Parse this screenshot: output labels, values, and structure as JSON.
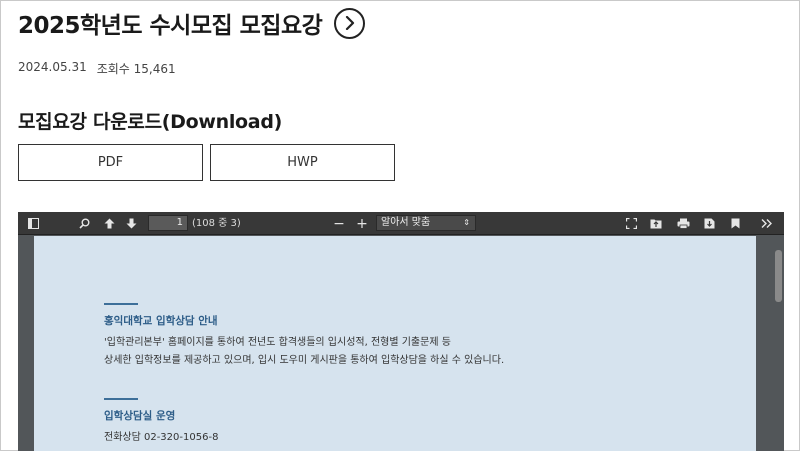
{
  "header": {
    "title": "2025학년도 수시모집 모집요강",
    "date": "2024.05.31",
    "views": "조회수 15,461"
  },
  "download": {
    "heading": "모집요강 다운로드(Download)",
    "buttons": [
      "PDF",
      "HWP"
    ]
  },
  "viewer": {
    "toolbar": {
      "page_number": "1",
      "page_count": "(108 중 3)",
      "zoom_label": "알아서 맞춤",
      "zoom_out": "−",
      "zoom_in": "+",
      "icons": [
        "sidebar-toggle-icon",
        "search-icon",
        "prev-page-icon",
        "next-page-icon",
        "zoom-out-icon",
        "zoom-in-icon",
        "fullscreen-icon",
        "open-file-icon",
        "print-icon",
        "download-icon",
        "bookmark-icon",
        "more-tools-icon"
      ]
    },
    "document": {
      "section1": {
        "heading": "홍익대학교 입학상담 안내",
        "lines": [
          "'입학관리본부' 홈페이지를 통하여 전년도 합격생들의 입시성적, 전형별 기출문제 등",
          "상세한 입학정보를 제공하고 있으며, 입시 도우미 게시판을 통하여 입학상담을 하실 수 있습니다."
        ]
      },
      "section2": {
        "heading": "입학상담실 운영",
        "lines": [
          "전화상담 02-320-1056-8"
        ]
      }
    }
  },
  "colors": {
    "toolbar_bg": "#383838",
    "viewer_bg": "#525659",
    "page_bg": "#d6e3ee",
    "accent": "#2d5d88"
  }
}
